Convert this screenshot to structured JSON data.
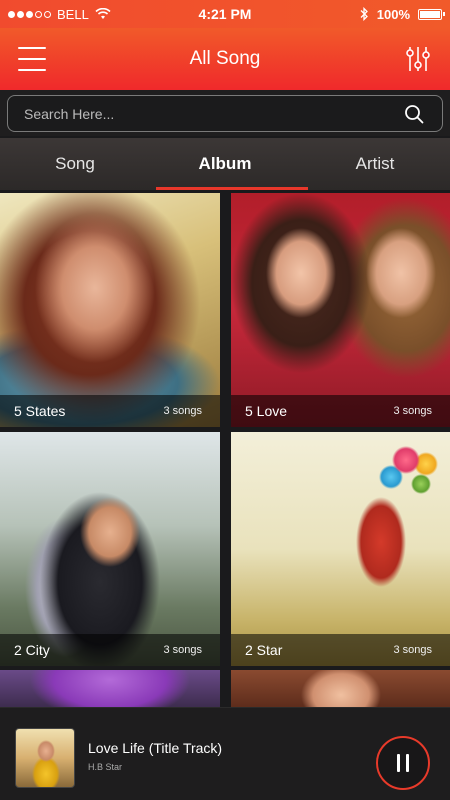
{
  "status_bar": {
    "carrier": "BELL",
    "time": "4:21 PM",
    "battery": "100%",
    "signal_bars": 3
  },
  "header": {
    "title": "All Song",
    "menu_icon": "hamburger-menu-icon",
    "settings_icon": "equalizer-icon"
  },
  "search": {
    "placeholder": "Search Here..."
  },
  "tabs": [
    {
      "label": "Song",
      "active": false
    },
    {
      "label": "Album",
      "active": true
    },
    {
      "label": "Artist",
      "active": false
    }
  ],
  "albums": [
    {
      "name": "5 States",
      "count": "3 songs"
    },
    {
      "name": "5 Love",
      "count": "3 songs"
    },
    {
      "name": "2 City",
      "count": "3 songs"
    },
    {
      "name": "2 Star",
      "count": "3 songs"
    }
  ],
  "now_playing": {
    "title": "Love Life (Title Track)",
    "artist": "H.B Star",
    "state": "playing"
  },
  "colors": {
    "accent": "#f0292b",
    "header_top": "#f15a2a",
    "background": "#1a1a1c"
  }
}
